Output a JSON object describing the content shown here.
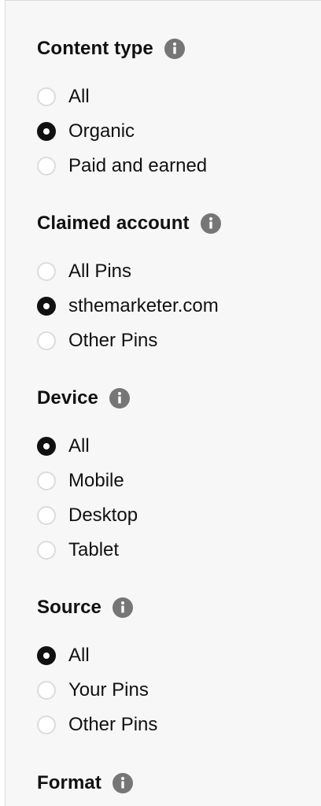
{
  "filters": {
    "content_type": {
      "title": "Content type",
      "info_icon": "info-icon",
      "options": [
        {
          "label": "All",
          "selected": false
        },
        {
          "label": "Organic",
          "selected": true
        },
        {
          "label": "Paid and earned",
          "selected": false
        }
      ]
    },
    "claimed_account": {
      "title": "Claimed account",
      "info_icon": "info-icon",
      "options": [
        {
          "label": "All Pins",
          "selected": false
        },
        {
          "label": "sthemarketer.com",
          "selected": true
        },
        {
          "label": "Other Pins",
          "selected": false
        }
      ]
    },
    "device": {
      "title": "Device",
      "info_icon": "info-icon",
      "options": [
        {
          "label": "All",
          "selected": true
        },
        {
          "label": "Mobile",
          "selected": false
        },
        {
          "label": "Desktop",
          "selected": false
        },
        {
          "label": "Tablet",
          "selected": false
        }
      ]
    },
    "source": {
      "title": "Source",
      "info_icon": "info-icon",
      "options": [
        {
          "label": "All",
          "selected": true
        },
        {
          "label": "Your Pins",
          "selected": false
        },
        {
          "label": "Other Pins",
          "selected": false
        }
      ]
    },
    "format": {
      "title": "Format",
      "info_icon": "info-icon"
    }
  },
  "colors": {
    "panel_background": "#f7f7f7",
    "text": "#111111",
    "info_icon": "#767676",
    "radio_border": "#dcdcdc",
    "radio_selected": "#111111"
  }
}
